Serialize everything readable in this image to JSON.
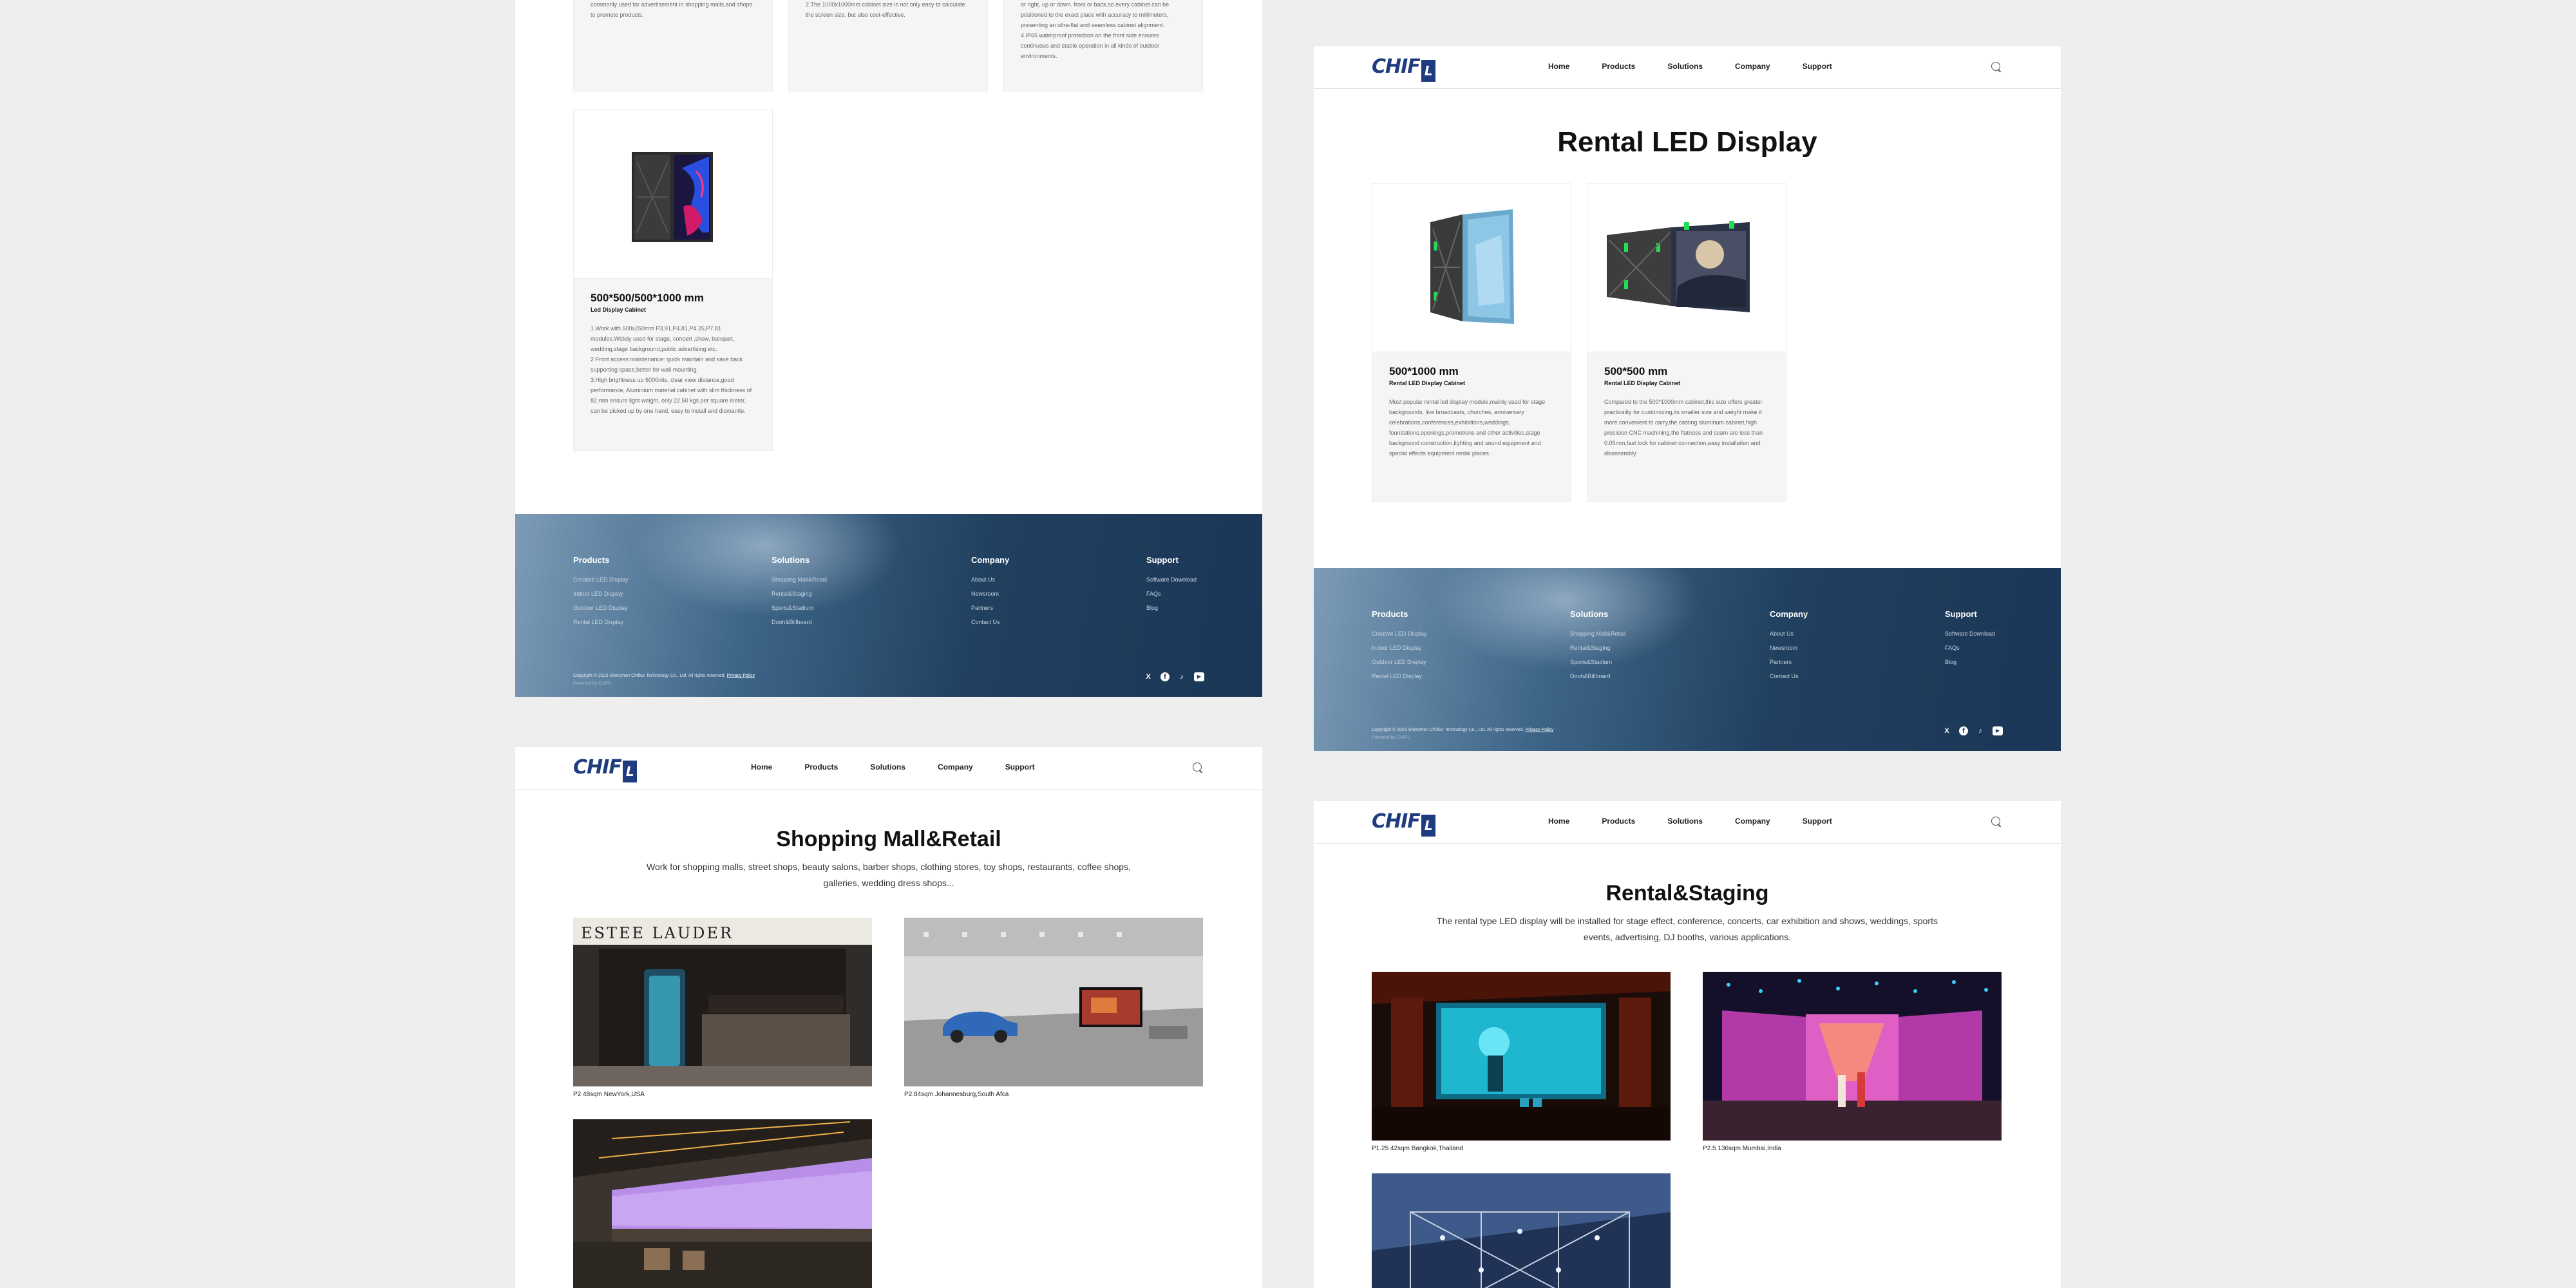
{
  "header": {
    "logo_text": "CHIF",
    "logo_mark": "L",
    "nav": [
      "Home",
      "Products",
      "Solutions",
      "Company",
      "Support"
    ],
    "search_icon": "search-icon"
  },
  "panel_top_left": {
    "partial_cards": [
      {
        "text": "commonly used for advertisement in shopping malls,and shops to promote products."
      },
      {
        "text": "2.The 1000x1000mm cabinet size is not only easy to calculate the screen size, but also cost-effective."
      },
      {
        "text": "or right, up or down. front or back,so every cabinet can be positioned to the exact place with accuracy to millimeters, presenting an ultra-flat and seamless cabinet alignment.\n4.IP65 waterproof protection on the front side ensures continuous and stable operation in all kinds of outdoor environments."
      }
    ],
    "card": {
      "title": "500*500/500*1000 mm",
      "subtitle": "Led Display Cabinet",
      "text": "1.Work with 500x250mm P3.91,P4.81,P4.25,P7.81 modules.Widely used for stage, concert ,show, banquet, wedding,stage background,public advertising etc.\n2.Front access maintenance: quick maintain and save back supporting space,better for wall mounting.\n3.High brightness up 6000nits, clear view distance,good performance, Aluminium material cabinet with slim thickness of 82 mm ensure light weight, only 22.50 kgs per square meter, can be picked up by one hand, easy to install and dismantle."
    }
  },
  "panel_top_right": {
    "title": "Rental LED Display",
    "cards": [
      {
        "title": "500*1000 mm",
        "subtitle": "Rental LED Display Cabinet",
        "text": "Most popular rental led display module,mainly used for stage backgrounds, live broadcasts, churches, anniversary celebrations,conferences,exhibitions,weddings, foundations,openings,promotions and other activities,stage background construction,lighting and sound equipment and special effects equipment rental places."
      },
      {
        "title": "500*500 mm",
        "subtitle": "Rental LED Display Cabinet",
        "text": "Compared to the 500*1000mm cabinet,this size offers greater practicality for customizing,its smaller size and weight make it more convenient to carry,the casting aluminum cabinet,high precision CNC machining,the flatness and seam are less than 0.05mm,fast lock for cabinet connection,easy installation and disassembly."
      }
    ]
  },
  "panel_bottom_left": {
    "title": "Shopping Mall&Retail",
    "desc": "Work for shopping malls, street shops, beauty salons, barber shops, clothing stores, toy shops, restaurants, coffee shops, galleries, wedding dress shops...",
    "cases": [
      {
        "caption": "P2 48sqm NewYork,USA",
        "store_sign": "ESTEE LAUDER"
      },
      {
        "caption": "P2.84sqm Johannesburg,South Afca"
      },
      {
        "caption": ""
      }
    ]
  },
  "panel_bottom_right": {
    "title": "Rental&Staging",
    "desc": "The rental type LED display will be installed for stage effect, conference, concerts, car exhibition and shows, weddings, sports events, advertising, DJ booths, various applications.",
    "cases": [
      {
        "caption": "P1.25 42sqm Bangkok,Thailand"
      },
      {
        "caption": "P2.5 136sqm Mumbai,India"
      },
      {
        "caption": ""
      }
    ]
  },
  "footer": {
    "columns": [
      {
        "title": "Products",
        "items": [
          "Creative LED Display",
          "Indoor LED Display",
          "Outdoor LED Display",
          "Rental LED Display"
        ]
      },
      {
        "title": "Solutions",
        "items": [
          "Shopping Mall&Retail",
          "Rental&Staging",
          "Sports&Stadium",
          "Dooh&Billboard"
        ]
      },
      {
        "title": "Company",
        "items": [
          "About Us",
          "Newsroom",
          "Partners",
          "Contact Us"
        ]
      },
      {
        "title": "Support",
        "items": [
          "Software Download",
          "FAQs",
          "Blog"
        ]
      }
    ],
    "copyright": "Copyright © 2023 Shenzhen Chiflux Technology Co., Ltd. All rights reserved.",
    "privacy": "Privacy Policy",
    "powered": "Powered by CHIFL",
    "social": [
      "x-icon",
      "facebook-icon",
      "tiktok-icon",
      "youtube-icon"
    ]
  }
}
